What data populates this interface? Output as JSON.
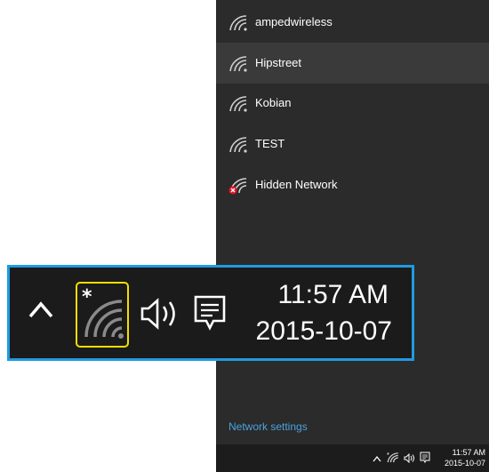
{
  "networks": [
    {
      "name": "ampedwireless",
      "icon": "wifi-icon"
    },
    {
      "name": "Hipstreet",
      "icon": "wifi-icon"
    },
    {
      "name": "Kobian",
      "icon": "wifi-icon"
    },
    {
      "name": "TEST",
      "icon": "wifi-icon"
    },
    {
      "name": "Hidden Network",
      "icon": "wifi-error-icon"
    }
  ],
  "network_settings_label": "Network settings",
  "taskbar": {
    "time": "11:57 AM",
    "date": "2015-10-07"
  },
  "zoom": {
    "time": "11:57 AM",
    "date": "2015-10-07"
  },
  "colors": {
    "flyout_bg": "#2b2b2b",
    "accent_link": "#4aa3e0",
    "highlight_border": "#1e9be0",
    "wifi_highlight": "#f2e000",
    "error_red": "#e81123"
  }
}
